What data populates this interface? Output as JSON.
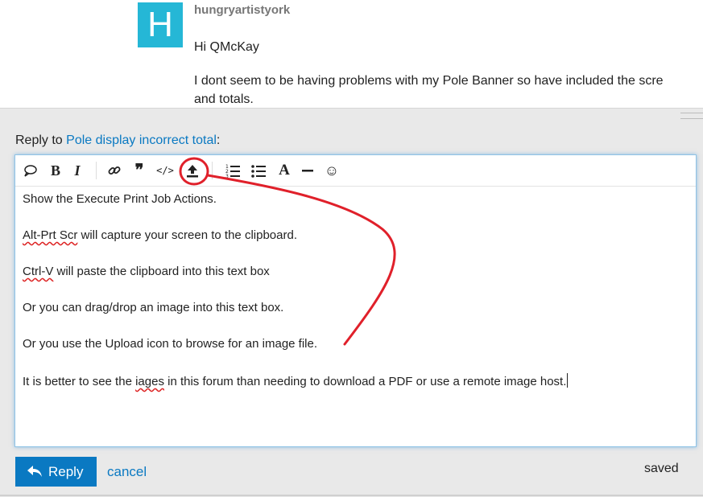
{
  "post": {
    "avatar_letter": "H",
    "username": "hungryartistyork",
    "greeting": "Hi QMcKay",
    "line1": "I dont seem to be having problems with my Pole Banner so have included the scre",
    "line2": "and totals."
  },
  "composer": {
    "reply_prefix": "Reply to ",
    "topic_link": "Pole display incorrect total",
    "reply_suffix": ":",
    "toolbar_icons": [
      "quote-icon",
      "bold-icon",
      "italic-icon",
      "link-icon",
      "blockquote-icon",
      "code-icon",
      "upload-icon",
      "numbered-list-icon",
      "bulleted-list-icon",
      "font-icon",
      "horizontal-rule-icon",
      "emoji-icon"
    ],
    "bold_glyph": "B",
    "italic_glyph": "I",
    "quote_glyph": "❞",
    "font_glyph": "A",
    "emoji_glyph": "☺",
    "code_glyph": "</>",
    "paragraphs": {
      "p1": "Show the Execute Print Job Actions.",
      "p2a": "Alt-Prt Scr",
      "p2b": " will capture your screen to the clipboard.",
      "p3a": "Ctrl-V",
      "p3b": " will paste the clipboard into this text box",
      "p4": "Or you can drag/drop an image into this text box.",
      "p5": "Or you use the Upload icon to browse for an image file.",
      "p6a": "It is better to see the ",
      "p6b": "iages",
      "p6c": " in this forum than needing to download a PDF or use a remote image host."
    },
    "reply_button": "Reply",
    "cancel_link": "cancel",
    "status": "saved"
  },
  "colors": {
    "accent": "#0a79c2",
    "avatar": "#25b7d6",
    "annotation": "#e0202a"
  }
}
